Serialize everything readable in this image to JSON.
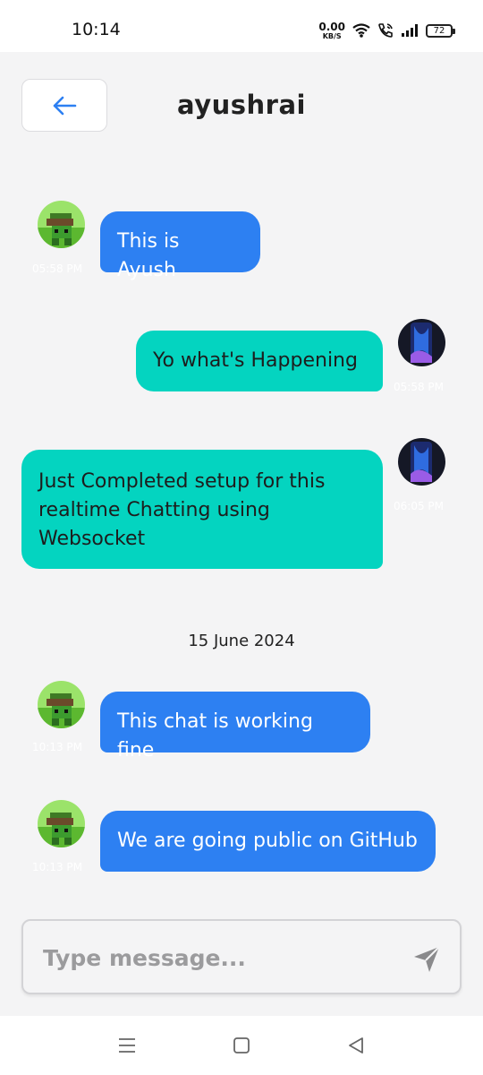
{
  "status": {
    "time": "10:14",
    "net_speed_value": "0.00",
    "net_speed_unit": "KB/S",
    "battery": "72"
  },
  "header": {
    "back_icon": "arrow-left-icon",
    "title": "ayushrai"
  },
  "messages": [
    {
      "direction": "in",
      "text": "This is Ayush",
      "time": "05:58 PM"
    },
    {
      "direction": "out",
      "text": "Yo what's Happening",
      "time": "05:58 PM"
    },
    {
      "direction": "out",
      "text": "Just Completed setup for this realtime Chatting using Websocket",
      "time": "06:05 PM"
    },
    {
      "direction": "in",
      "text": "This chat is working fine",
      "time": "10:13 PM"
    },
    {
      "direction": "in",
      "text": "We are going public on GitHub",
      "time": "10:13 PM"
    }
  ],
  "date_separator": "15 June 2024",
  "composer": {
    "placeholder": "Type message...",
    "value": "",
    "send_icon": "send-icon"
  },
  "nav": {
    "menu_icon": "menu-icon",
    "home_icon": "home-square-icon",
    "back_icon": "back-triangle-icon"
  },
  "colors": {
    "incoming_bubble": "#2d80f2",
    "outgoing_bubble": "#04d4c0",
    "background": "#f4f4f5",
    "back_arrow": "#2d80f2"
  }
}
